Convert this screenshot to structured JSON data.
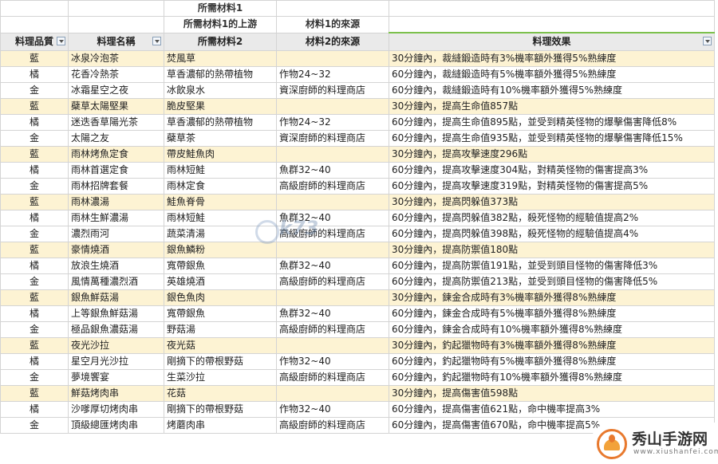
{
  "headers": {
    "row1": [
      "",
      "",
      "所需材料1",
      "",
      ""
    ],
    "row2": [
      "",
      "",
      "所需材料1的上游",
      "材料1的來源",
      ""
    ],
    "row3": [
      "料理品質",
      "料理名稱",
      "所需材料2",
      "材料2的來源",
      "料理效果"
    ]
  },
  "rows": [
    [
      "藍",
      "冰泉冷泡茶",
      "焚風草",
      "",
      "30分鐘內，裁縫鍛造時有3%機率額外獲得5%熟練度"
    ],
    [
      "橘",
      "花香冷熱茶",
      "草香濃郁的熱帶植物",
      "作物24~32",
      "60分鐘內，裁縫鍛造時有5%機率額外獲得5%熟練度"
    ],
    [
      "金",
      "冰霜星空之夜",
      "冰飲泉水",
      "資深廚師的料理商店",
      "60分鐘內，裁縫鍛造時有10%機率額外獲得5%熟練度"
    ],
    [
      "藍",
      "蘗草太陽堅果",
      "脆皮堅果",
      "",
      "30分鐘內，提高生命值857點"
    ],
    [
      "橘",
      "迷迭香草陽光茶",
      "草香濃郁的熱帶植物",
      "作物24~32",
      "60分鐘內，提高生命值895點，並受到精英怪物的爆擊傷害降低8%"
    ],
    [
      "金",
      "太陽之友",
      "蘗草茶",
      "資深廚師的料理商店",
      "60分鐘內，提高生命值935點，並受到精英怪物的爆擊傷害降低15%"
    ],
    [
      "藍",
      "雨林烤魚定食",
      "帶皮鮭魚肉",
      "",
      "30分鐘內，提高攻擊速度296點"
    ],
    [
      "橘",
      "雨林首選定食",
      "雨林短鮭",
      "魚群32~40",
      "60分鐘內，提高攻擊速度304點，對精英怪物的傷害提高3%"
    ],
    [
      "金",
      "雨林招牌套餐",
      "雨林定食",
      "高級廚師的料理商店",
      "60分鐘內，提高攻擊速度319點，對精英怪物的傷害提高5%"
    ],
    [
      "藍",
      "雨林濃湯",
      "鮭魚脊骨",
      "",
      "30分鐘內，提高閃躲值373點"
    ],
    [
      "橘",
      "雨林生鮮濃湯",
      "雨林短鮭",
      "魚群32~40",
      "60分鐘內，提高閃躲值382點，殺死怪物的經驗值提高2%"
    ],
    [
      "金",
      "濃烈雨河",
      "蔬菜清湯",
      "高級廚師的料理商店",
      "60分鐘內，提高閃躲值398點，殺死怪物的經驗值提高4%"
    ],
    [
      "藍",
      "豪情燒酒",
      "銀魚鱗粉",
      "",
      "30分鐘內，提高防禦值180點"
    ],
    [
      "橘",
      "放浪生燒酒",
      "寬帶銀魚",
      "魚群32~40",
      "60分鐘內，提高防禦值191點，並受到頭目怪物的傷害降低3%"
    ],
    [
      "金",
      "風情萬種濃烈酒",
      "英雄燒酒",
      "高級廚師的料理商店",
      "60分鐘內，提高防禦值213點，並受到頭目怪物的傷害降低5%"
    ],
    [
      "藍",
      "銀魚鮮菇湯",
      "銀色魚肉",
      "",
      "30分鐘內，鍊金合成時有3%機率額外獲得8%熟練度"
    ],
    [
      "橘",
      "上等銀魚鮮菇湯",
      "寬帶銀魚",
      "魚群32~40",
      "60分鐘內，鍊金合成時有5%機率額外獲得8%熟練度"
    ],
    [
      "金",
      "極品銀魚濃菇湯",
      "野菇湯",
      "高級廚師的料理商店",
      "60分鐘內，鍊金合成時有10%機率額外獲得8%熟練度"
    ],
    [
      "藍",
      "夜光沙拉",
      "夜光菇",
      "",
      "30分鐘內，釣起獵物時有3%機率額外獲得8%熟練度"
    ],
    [
      "橘",
      "星空月光沙拉",
      "剛摘下的帶根野菇",
      "作物32~40",
      "60分鐘內，釣起獵物時有5%機率額外獲得8%熟練度"
    ],
    [
      "金",
      "夢境饗宴",
      "生菜沙拉",
      "高級廚師的料理商店",
      "60分鐘內，釣起獵物時有10%機率額外獲得8%熟練度"
    ],
    [
      "藍",
      "鮮菇烤肉串",
      "花菇",
      "",
      "30分鐘內，提高傷害值598點"
    ],
    [
      "橘",
      "沙嗲厚切烤肉串",
      "剛摘下的帶根野菇",
      "作物32~40",
      "60分鐘內，提高傷害值621點，命中機率提高3%"
    ],
    [
      "金",
      "頂級總匯烤肉串",
      "烤蘑肉串",
      "高級廚師的料理商店",
      "60分鐘內，提高傷害值670點，命中機率提高5%"
    ]
  ],
  "watermark": "k73",
  "logo": {
    "name": "秀山手游网",
    "url": "www.xiushanfei.com"
  },
  "colors": {
    "stripe": "#fdf3d3",
    "header": "#eaeaea",
    "accent": "#7cc04c"
  }
}
